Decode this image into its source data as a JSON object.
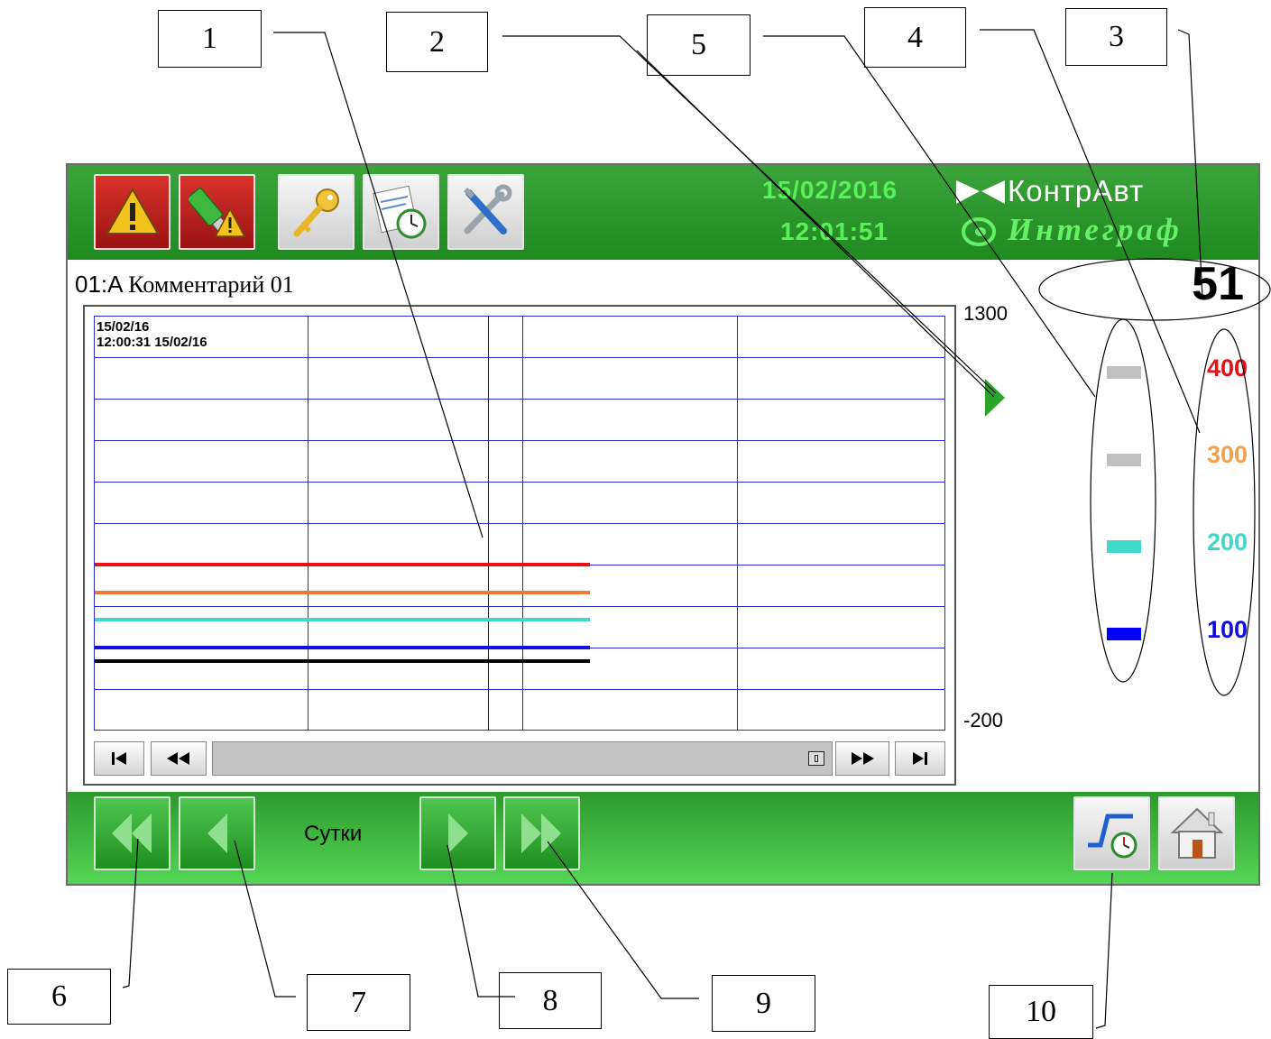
{
  "callouts": [
    "1",
    "2",
    "3",
    "4",
    "5",
    "6",
    "7",
    "8",
    "9",
    "10"
  ],
  "header": {
    "date": "15/02/2016",
    "time": "12:01:51",
    "brand_top": "КонтрАвт",
    "brand_bottom": "Интеграф",
    "buttons": [
      "alarm-icon",
      "usb-alarm-icon",
      "key-icon",
      "schedule-icon",
      "tools-icon"
    ]
  },
  "channel": {
    "id": "01:A",
    "comment": "Комментарий 01",
    "current_value": "51"
  },
  "chart": {
    "scale_max": "1300",
    "scale_min": "-200",
    "start_date": "15/02/16",
    "cursor_time": "12:00:31",
    "cursor_date": "15/02/16"
  },
  "setpoints": [
    {
      "value": "400",
      "color": "#e81010",
      "marker_color": "#c0c0c0"
    },
    {
      "value": "300",
      "color": "#f0a050",
      "marker_color": "#c0c0c0"
    },
    {
      "value": "200",
      "color": "#40d8c8",
      "marker_color": "#40d8c8"
    },
    {
      "value": "100",
      "color": "#1010e0",
      "marker_color": "#0000ff"
    }
  ],
  "trends": [
    {
      "color": "#e81010"
    },
    {
      "color": "#f07830"
    },
    {
      "color": "#40d8c8"
    },
    {
      "color": "#1010e0"
    },
    {
      "color": "#000000"
    }
  ],
  "footer": {
    "period_label": "Сутки",
    "buttons": [
      "fast-back-icon",
      "back-icon",
      "forward-icon",
      "fast-forward-icon",
      "trend-history-icon",
      "home-icon"
    ]
  },
  "colors": {
    "bar_green": "#1f8a1f",
    "grid_blue": "#2a2ad0",
    "date_green": "#5af05a"
  }
}
